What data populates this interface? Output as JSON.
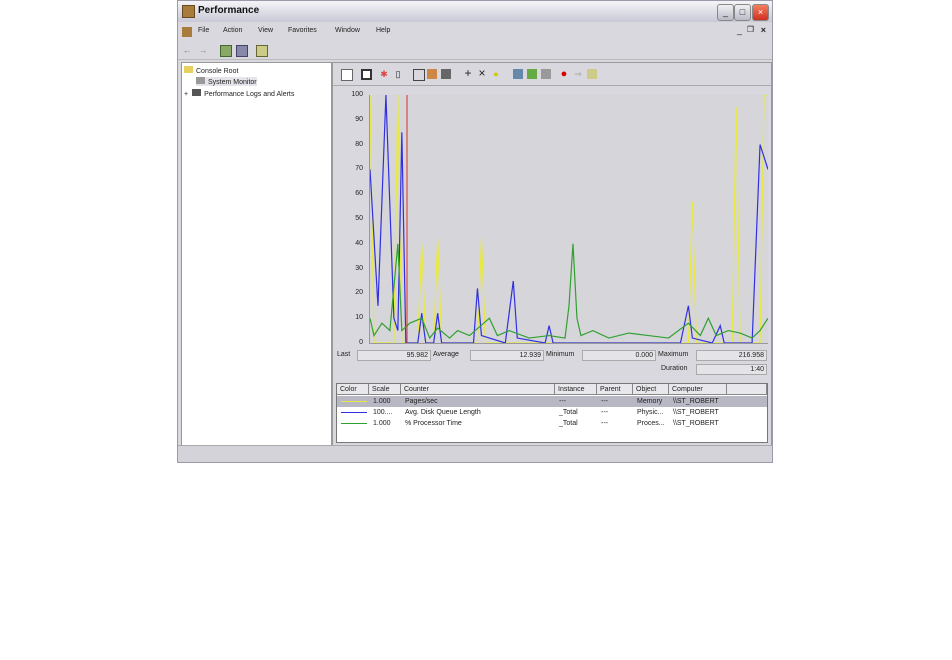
{
  "window": {
    "title": "Performance"
  },
  "menu": [
    "File",
    "Action",
    "View",
    "Favorites",
    "Window",
    "Help"
  ],
  "tree": {
    "items": [
      "Console Root",
      "System Monitor",
      "Performance Logs and Alerts"
    ]
  },
  "stats": {
    "last_label": "Last",
    "last": "95.982",
    "avg_label": "Average",
    "avg": "12.939",
    "min_label": "Minimum",
    "min": "0.000",
    "max_label": "Maximum",
    "max": "216.958",
    "dur_label": "Duration",
    "dur": "1:40"
  },
  "table": {
    "headers": [
      "Color",
      "Scale",
      "Counter",
      "Instance",
      "Parent",
      "Object",
      "Computer"
    ],
    "rows": [
      {
        "color": "#e8e840",
        "scale": "1.000",
        "counter": "Pages/sec",
        "instance": "---",
        "parent": "---",
        "object": "Memory",
        "computer": "\\\\ST_ROBERT"
      },
      {
        "color": "#3030e0",
        "scale": "100....",
        "counter": "Avg. Disk Queue Length",
        "instance": "_Total",
        "parent": "---",
        "object": "Physic...",
        "computer": "\\\\ST_ROBERT"
      },
      {
        "color": "#30a030",
        "scale": "1.000",
        "counter": "% Processor Time",
        "instance": "_Total",
        "parent": "---",
        "object": "Proces...",
        "computer": "\\\\ST_ROBERT"
      }
    ]
  },
  "chart_data": {
    "type": "line",
    "ylim": [
      0,
      100
    ],
    "xlim": [
      0,
      100
    ],
    "yticks": [
      "0",
      "10",
      "20",
      "30",
      "40",
      "50",
      "60",
      "70",
      "80",
      "90",
      "100"
    ],
    "cursor_x": 9.3,
    "series": [
      {
        "name": "Pages/sec",
        "color": "#e8e840",
        "points": [
          [
            0,
            100
          ],
          [
            1,
            0
          ],
          [
            6,
            0
          ],
          [
            7,
            100
          ],
          [
            8,
            0
          ],
          [
            12,
            0
          ],
          [
            13,
            40
          ],
          [
            14,
            0
          ],
          [
            16,
            0
          ],
          [
            17,
            42
          ],
          [
            18,
            0
          ],
          [
            27,
            0
          ],
          [
            28,
            42
          ],
          [
            29,
            0
          ],
          [
            80,
            0
          ],
          [
            81,
            57
          ],
          [
            82,
            0
          ],
          [
            91,
            0
          ],
          [
            92,
            95
          ],
          [
            93,
            0
          ],
          [
            98,
            0
          ],
          [
            99,
            100
          ],
          [
            100,
            100
          ]
        ]
      },
      {
        "name": "Avg. Disk Queue Length",
        "color": "#3030e0",
        "points": [
          [
            0,
            70
          ],
          [
            2,
            15
          ],
          [
            4,
            100
          ],
          [
            6,
            10
          ],
          [
            7,
            5
          ],
          [
            8,
            85
          ],
          [
            9,
            0
          ],
          [
            12,
            0
          ],
          [
            13,
            12
          ],
          [
            14,
            0
          ],
          [
            16,
            0
          ],
          [
            17,
            12
          ],
          [
            18,
            0
          ],
          [
            26,
            0
          ],
          [
            27,
            22
          ],
          [
            28,
            3
          ],
          [
            34,
            0
          ],
          [
            36,
            25
          ],
          [
            37,
            2
          ],
          [
            44,
            0
          ],
          [
            45,
            7
          ],
          [
            46,
            0
          ],
          [
            78,
            0
          ],
          [
            80,
            15
          ],
          [
            81,
            2
          ],
          [
            86,
            0
          ],
          [
            88,
            7
          ],
          [
            89,
            0
          ],
          [
            96,
            0
          ],
          [
            98,
            80
          ],
          [
            100,
            70
          ]
        ]
      },
      {
        "name": "% Processor Time",
        "color": "#30a030",
        "points": [
          [
            0,
            10
          ],
          [
            1,
            3
          ],
          [
            3,
            8
          ],
          [
            5,
            5
          ],
          [
            7,
            40
          ],
          [
            8,
            5
          ],
          [
            10,
            8
          ],
          [
            13,
            10
          ],
          [
            15,
            2
          ],
          [
            17,
            6
          ],
          [
            20,
            2
          ],
          [
            22,
            5
          ],
          [
            25,
            3
          ],
          [
            30,
            10
          ],
          [
            32,
            3
          ],
          [
            35,
            5
          ],
          [
            40,
            2
          ],
          [
            45,
            3
          ],
          [
            49,
            2
          ],
          [
            50,
            15
          ],
          [
            51,
            40
          ],
          [
            52,
            10
          ],
          [
            53,
            3
          ],
          [
            56,
            5
          ],
          [
            60,
            2
          ],
          [
            65,
            4
          ],
          [
            70,
            3
          ],
          [
            75,
            2
          ],
          [
            80,
            8
          ],
          [
            83,
            3
          ],
          [
            85,
            10
          ],
          [
            87,
            3
          ],
          [
            90,
            5
          ],
          [
            93,
            4
          ],
          [
            96,
            2
          ],
          [
            98,
            5
          ],
          [
            100,
            10
          ]
        ]
      }
    ]
  }
}
